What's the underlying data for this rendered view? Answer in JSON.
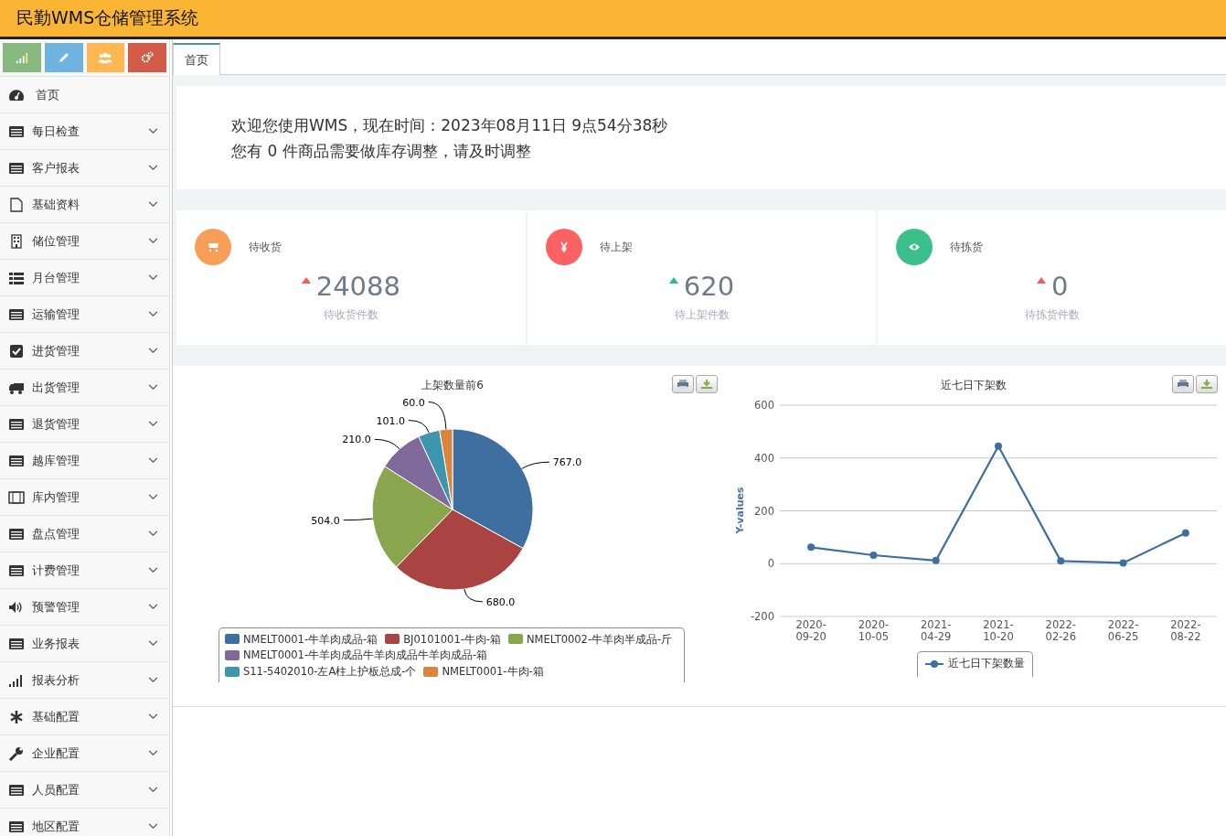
{
  "header": {
    "title": "民勤WMS仓储管理系统"
  },
  "shortcuts": [
    {
      "kind": "signal",
      "color": "#87b87f"
    },
    {
      "kind": "pencil",
      "color": "#6fb3e0"
    },
    {
      "kind": "users",
      "color": "#ffb752"
    },
    {
      "kind": "cogs",
      "color": "#d15b47"
    }
  ],
  "sidebar": {
    "items": [
      {
        "label": "首页",
        "expandable": false
      },
      {
        "label": "每日检查",
        "expandable": true
      },
      {
        "label": "客户报表",
        "expandable": true
      },
      {
        "label": "基础资料",
        "expandable": true
      },
      {
        "label": "储位管理",
        "expandable": true
      },
      {
        "label": "月台管理",
        "expandable": true
      },
      {
        "label": "运输管理",
        "expandable": true
      },
      {
        "label": "进货管理",
        "expandable": true
      },
      {
        "label": "出货管理",
        "expandable": true
      },
      {
        "label": "退货管理",
        "expandable": true
      },
      {
        "label": "越库管理",
        "expandable": true
      },
      {
        "label": "库内管理",
        "expandable": true
      },
      {
        "label": "盘点管理",
        "expandable": true
      },
      {
        "label": "计费管理",
        "expandable": true
      },
      {
        "label": "预警管理",
        "expandable": true
      },
      {
        "label": "业务报表",
        "expandable": true
      },
      {
        "label": "报表分析",
        "expandable": true
      },
      {
        "label": "基础配置",
        "expandable": true
      },
      {
        "label": "企业配置",
        "expandable": true
      },
      {
        "label": "人员配置",
        "expandable": true
      },
      {
        "label": "地区配置",
        "expandable": true
      }
    ]
  },
  "tabs": [
    {
      "label": "首页",
      "selected": true
    }
  ],
  "welcome": {
    "lines": [
      "欢迎您使用WMS，现在时间：2023年08月11日 9点54分38秒",
      "您有 0 件商品需要做库存调整，请及时调整"
    ]
  },
  "stats": [
    {
      "kind": "cart",
      "color": "#f79e59",
      "label": "待收货",
      "arrow": {
        "color": "#f8595b"
      },
      "value": "24088",
      "caption": "待收货件数"
    },
    {
      "kind": "yen",
      "color": "#fd6263",
      "label": "待上架",
      "arrow": {
        "color": "#2fb88a"
      },
      "value": "620",
      "caption": "待上架件数"
    },
    {
      "kind": "eye",
      "color": "#3bbf8c",
      "label": "待拣货",
      "arrow": {
        "color": "#f8595b"
      },
      "value": "0",
      "caption": "待拣货件数"
    }
  ],
  "pie_chart": {
    "chart_data": {
      "type": "pie",
      "title": "上架数量前6",
      "data_labels": true,
      "legend": "bottom",
      "categories": [
        "NMELT0001-牛羊肉成品-箱",
        "BJ0101001-牛肉-箱",
        "NMELT0002-牛羊肉半成品-斤",
        "NMELT0001-牛羊肉成品牛羊肉成品牛羊肉成品-箱",
        "S11-5402010-左A柱上护板总成-个",
        "NMELT0001-牛肉-箱"
      ],
      "values": [
        767,
        680,
        504,
        210,
        101,
        60
      ],
      "value_labels": [
        "767.0",
        "680.0",
        "504.0",
        "210.0",
        "101.0",
        "60.0"
      ],
      "colors": [
        "#3e6fa0",
        "#aa4443",
        "#89a54e",
        "#80699b",
        "#3d96ae",
        "#db843d"
      ]
    }
  },
  "line_chart": {
    "chart_data": {
      "type": "line",
      "title": "近七日下架数",
      "ylabel": "Y-values",
      "grid": true,
      "legend": "bottom",
      "categories": [
        "2020-\n09-20",
        "2020-\n10-05",
        "2021-\n04-29",
        "2021-\n10-20",
        "2022-\n02-26",
        "2022-\n06-25",
        "2022-\n08-22"
      ],
      "ylim": [
        -200,
        600
      ],
      "yticks": [
        -200,
        0,
        200,
        400,
        600
      ],
      "series": [
        {
          "name": "近七日下架数量",
          "color": "#3e6fa0",
          "marker": true,
          "values": [
            62,
            32,
            12,
            445,
            10,
            3,
            116
          ]
        }
      ]
    }
  }
}
